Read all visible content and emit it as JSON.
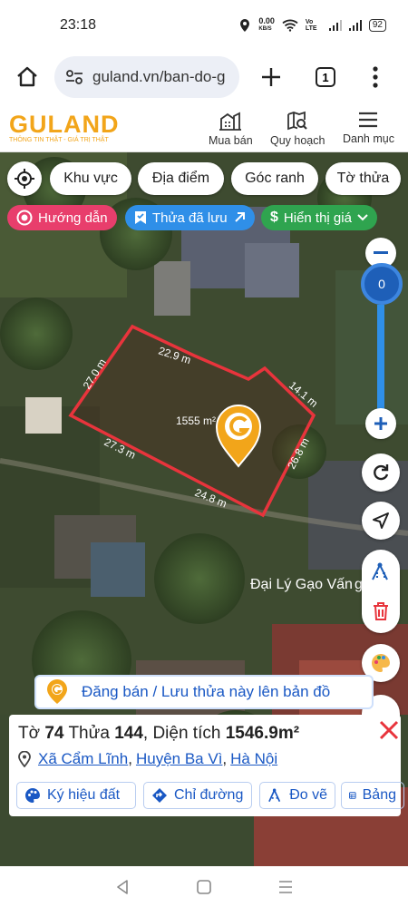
{
  "status_bar": {
    "time": "23:18",
    "net_speed": "0.00",
    "net_unit": "KB/S",
    "volte": "Vo LTE",
    "battery": "92"
  },
  "browser": {
    "url": "guland.vn/ban-do-g",
    "tab_count": "1"
  },
  "header": {
    "logo": "GULAND",
    "tagline": "THÔNG TIN THẬT - GIÁ TRỊ THẬT",
    "nav": [
      {
        "label": "Mua bán",
        "icon": "buildings-icon"
      },
      {
        "label": "Quy hoạch",
        "icon": "map-search-icon"
      },
      {
        "label": "Danh mục",
        "icon": "hamburger-icon"
      }
    ]
  },
  "toolbar": {
    "chips": [
      "Khu vực",
      "Địa điểm",
      "Góc ranh",
      "Tờ thửa"
    ],
    "guide_label": "Hướng dẫn",
    "saved_label": "Thửa đã lưu",
    "price_label": "Hiển thị giá"
  },
  "map": {
    "zoom_level": "0",
    "edge_labels": [
      "22.9 m",
      "14.1 m",
      "26.8 m",
      "24.8 m",
      "27.3 m",
      "27.0 m"
    ],
    "area_label": "1555 m²",
    "poi_label": "Đại Lý Gạo Vấn",
    "poi_suffix": "g"
  },
  "post_banner": {
    "text": "Đăng bán / Lưu thửa này lên bản đồ"
  },
  "parcel": {
    "sheet_prefix": "Tờ",
    "sheet": "74",
    "plot_prefix": "Thửa",
    "plot": "144",
    "area_prefix": ", Diện tích",
    "area": "1546.9m²",
    "commune": "Xã Cẩm Lĩnh",
    "district": "Huyện Ba Vì",
    "city": "Hà Nội",
    "actions": [
      "Ký hiệu đất",
      "Chỉ đường",
      "Đo vẽ",
      "Bảng"
    ]
  },
  "colors": {
    "brand_orange": "#f2a51a",
    "primary_blue": "#1a58c4",
    "guide_pink": "#e83e6c",
    "saved_blue": "#2f8fe8",
    "price_green": "#2fa44f",
    "parcel_red": "#e8343c"
  }
}
